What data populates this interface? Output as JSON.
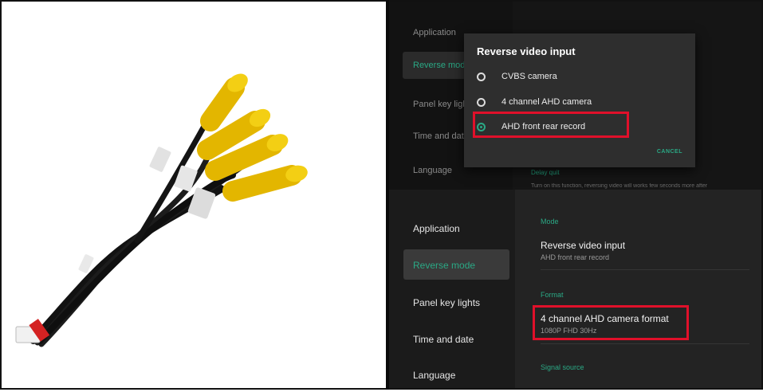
{
  "top_screen": {
    "sidebar": [
      {
        "label": "Application"
      },
      {
        "label": "Reverse mode"
      },
      {
        "label": "Panel key lights"
      },
      {
        "label": "Time and date"
      },
      {
        "label": "Language"
      }
    ],
    "dialog": {
      "title": "Reverse video input",
      "options": [
        {
          "label": "CVBS camera",
          "selected": false
        },
        {
          "label": "4 channel AHD camera",
          "selected": false
        },
        {
          "label": "AHD front rear record",
          "selected": true
        }
      ],
      "cancel_label": "CANCEL"
    },
    "behind": {
      "delay_quit": "Delay quit",
      "delay_quit_desc": "Turn on this function, reversing video will works few seconds more after"
    }
  },
  "bottom_screen": {
    "sidebar": [
      {
        "label": "Application"
      },
      {
        "label": "Reverse mode"
      },
      {
        "label": "Panel key lights"
      },
      {
        "label": "Time and date"
      },
      {
        "label": "Language"
      }
    ],
    "sections": {
      "mode": "Mode",
      "format": "Format",
      "signal": "Signal source"
    },
    "rows": {
      "reverse_title": "Reverse video input",
      "reverse_value": "AHD front rear record",
      "format_title": "4 channel AHD camera format",
      "format_value": "1080P FHD 30Hz"
    }
  },
  "colors": {
    "accent": "#2aa985",
    "highlight": "#e0102a"
  }
}
